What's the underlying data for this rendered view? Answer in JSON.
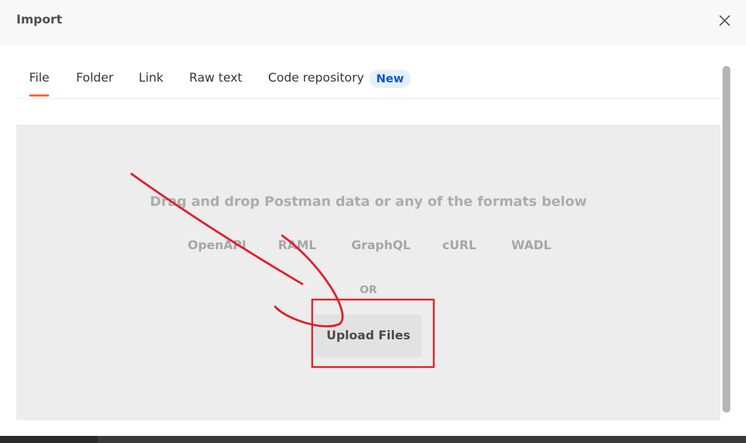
{
  "dialog": {
    "title": "Import",
    "close_icon": "close-icon"
  },
  "tabs": [
    {
      "label": "File",
      "active": true
    },
    {
      "label": "Folder"
    },
    {
      "label": "Link"
    },
    {
      "label": "Raw text"
    },
    {
      "label": "Code repository",
      "badge": "New"
    }
  ],
  "dropzone": {
    "heading": "Drag and drop Postman data or any of the formats below",
    "formats": [
      "OpenAPI",
      "RAML",
      "GraphQL",
      "cURL",
      "WADL"
    ],
    "or_text": "OR",
    "upload_label": "Upload Files"
  },
  "colors": {
    "tab_underline": "#f26b3a",
    "badge_text": "#0c5ac7",
    "annotation_red": "#e0202a"
  }
}
